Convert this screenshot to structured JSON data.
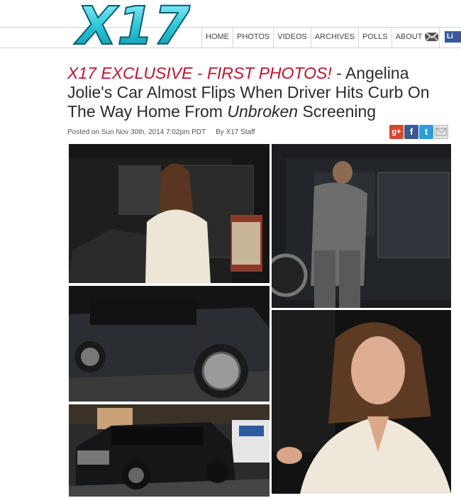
{
  "site": {
    "logo_text": "X17"
  },
  "nav": {
    "items": [
      "HOME",
      "PHOTOS",
      "VIDEOS",
      "ARCHIVES",
      "POLLS",
      "ABOUT US"
    ],
    "facebook_label": "Li"
  },
  "article": {
    "headline_exclusive": "X17 EXCLUSIVE - FIRST PHOTOS!",
    "headline_part1": " - Angelina Jolie's Car Almost Flips When Driver Hits Curb On The Way Home From ",
    "headline_italic": "Unbroken",
    "headline_part2": " Screening",
    "posted": "Posted on Sun Nov 30th, 2014 7:02pm PDT",
    "author": "By X17 Staff"
  },
  "share": {
    "gplus": "g+",
    "facebook": "f",
    "twitter": "t"
  },
  "colors": {
    "accent": "#c0142f",
    "logo": "#2ec4d6",
    "facebook": "#3b5998",
    "twitter": "#2c9fd6",
    "gplus": "#d3492f"
  },
  "icons": [
    "x17-logo",
    "mail-icon",
    "facebook-icon",
    "gplus-icon",
    "twitter-icon",
    "email-share-icon"
  ]
}
